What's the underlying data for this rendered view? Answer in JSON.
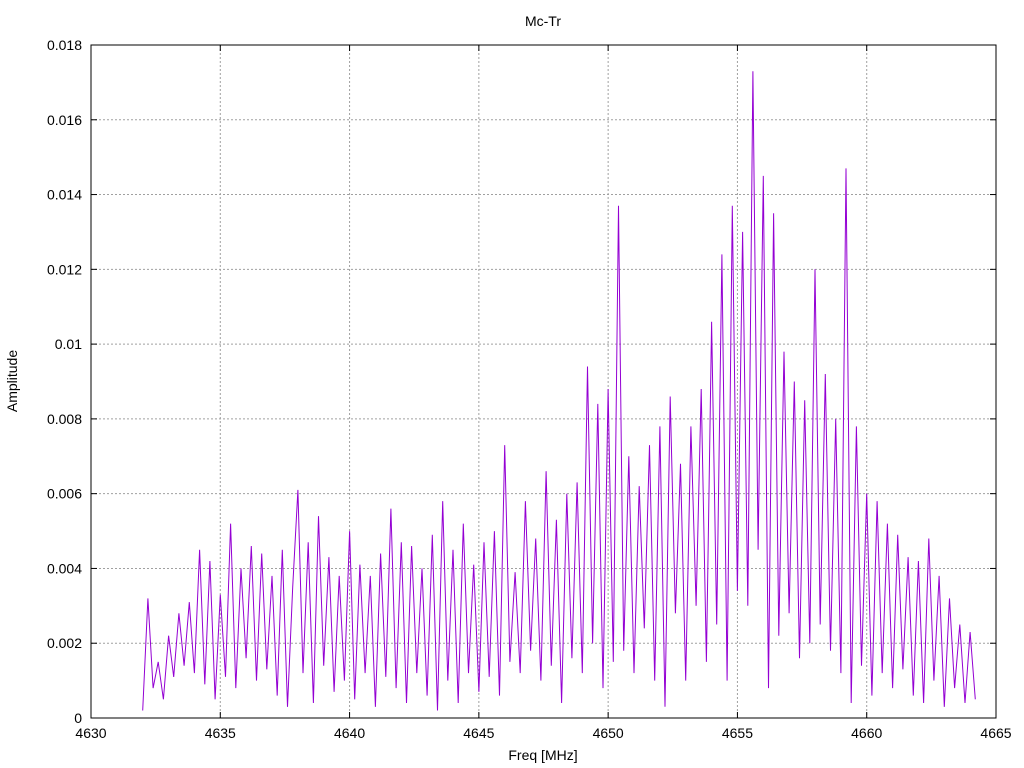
{
  "chart_data": {
    "type": "line",
    "title": "Mc-Tr",
    "xlabel": "Freq [MHz]",
    "ylabel": "Amplitude",
    "xlim": [
      4630,
      4665
    ],
    "ylim": [
      0,
      0.018
    ],
    "grid": true,
    "legend": "none",
    "x_ticks": [
      "4630",
      "4635",
      "4640",
      "4645",
      "4650",
      "4655",
      "4660",
      "4665"
    ],
    "y_ticks": [
      "0",
      "0.002",
      "0.004",
      "0.006",
      "0.008",
      "0.01",
      "0.012",
      "0.014",
      "0.016",
      "0.018"
    ],
    "series": [
      {
        "name": "Mc-Tr",
        "color": "#9400d3",
        "x_start": 4632,
        "x_step": 0.2,
        "values": [
          0.0002,
          0.0032,
          0.0008,
          0.0015,
          0.0005,
          0.0022,
          0.0011,
          0.0028,
          0.0014,
          0.0031,
          0.0012,
          0.0045,
          0.0009,
          0.0042,
          0.0005,
          0.0033,
          0.0011,
          0.0052,
          0.0008,
          0.004,
          0.0016,
          0.0046,
          0.001,
          0.0044,
          0.0013,
          0.0038,
          0.0006,
          0.0045,
          0.0003,
          0.0035,
          0.0061,
          0.0012,
          0.0047,
          0.0004,
          0.0054,
          0.0014,
          0.0043,
          0.0007,
          0.0038,
          0.001,
          0.005,
          0.0005,
          0.0041,
          0.0012,
          0.0038,
          0.0003,
          0.0044,
          0.0011,
          0.0056,
          0.0008,
          0.0047,
          0.0004,
          0.0046,
          0.0012,
          0.004,
          0.0006,
          0.0049,
          0.0002,
          0.0058,
          0.001,
          0.0045,
          0.0004,
          0.0052,
          0.0012,
          0.0041,
          0.0007,
          0.0047,
          0.0011,
          0.005,
          0.0006,
          0.0073,
          0.0015,
          0.0039,
          0.0012,
          0.0058,
          0.0018,
          0.0048,
          0.001,
          0.0066,
          0.0014,
          0.0053,
          0.0004,
          0.006,
          0.0016,
          0.0063,
          0.0012,
          0.0094,
          0.002,
          0.0084,
          0.0008,
          0.0088,
          0.0015,
          0.0137,
          0.0018,
          0.007,
          0.0012,
          0.0062,
          0.0024,
          0.0073,
          0.001,
          0.0078,
          0.0003,
          0.0086,
          0.0028,
          0.0068,
          0.001,
          0.0078,
          0.003,
          0.0088,
          0.0015,
          0.0106,
          0.0025,
          0.0124,
          0.001,
          0.0137,
          0.0034,
          0.013,
          0.003,
          0.0173,
          0.0045,
          0.0145,
          0.0008,
          0.0135,
          0.0022,
          0.0098,
          0.0028,
          0.009,
          0.0016,
          0.0085,
          0.002,
          0.012,
          0.0025,
          0.0092,
          0.0018,
          0.008,
          0.0012,
          0.0147,
          0.0004,
          0.0078,
          0.0014,
          0.006,
          0.0006,
          0.0058,
          0.0012,
          0.0052,
          0.0008,
          0.0049,
          0.0013,
          0.0043,
          0.0006,
          0.0042,
          0.0004,
          0.0048,
          0.001,
          0.0038,
          0.0003,
          0.0032,
          0.0008,
          0.0025,
          0.0004,
          0.0023,
          0.0005
        ]
      }
    ]
  }
}
